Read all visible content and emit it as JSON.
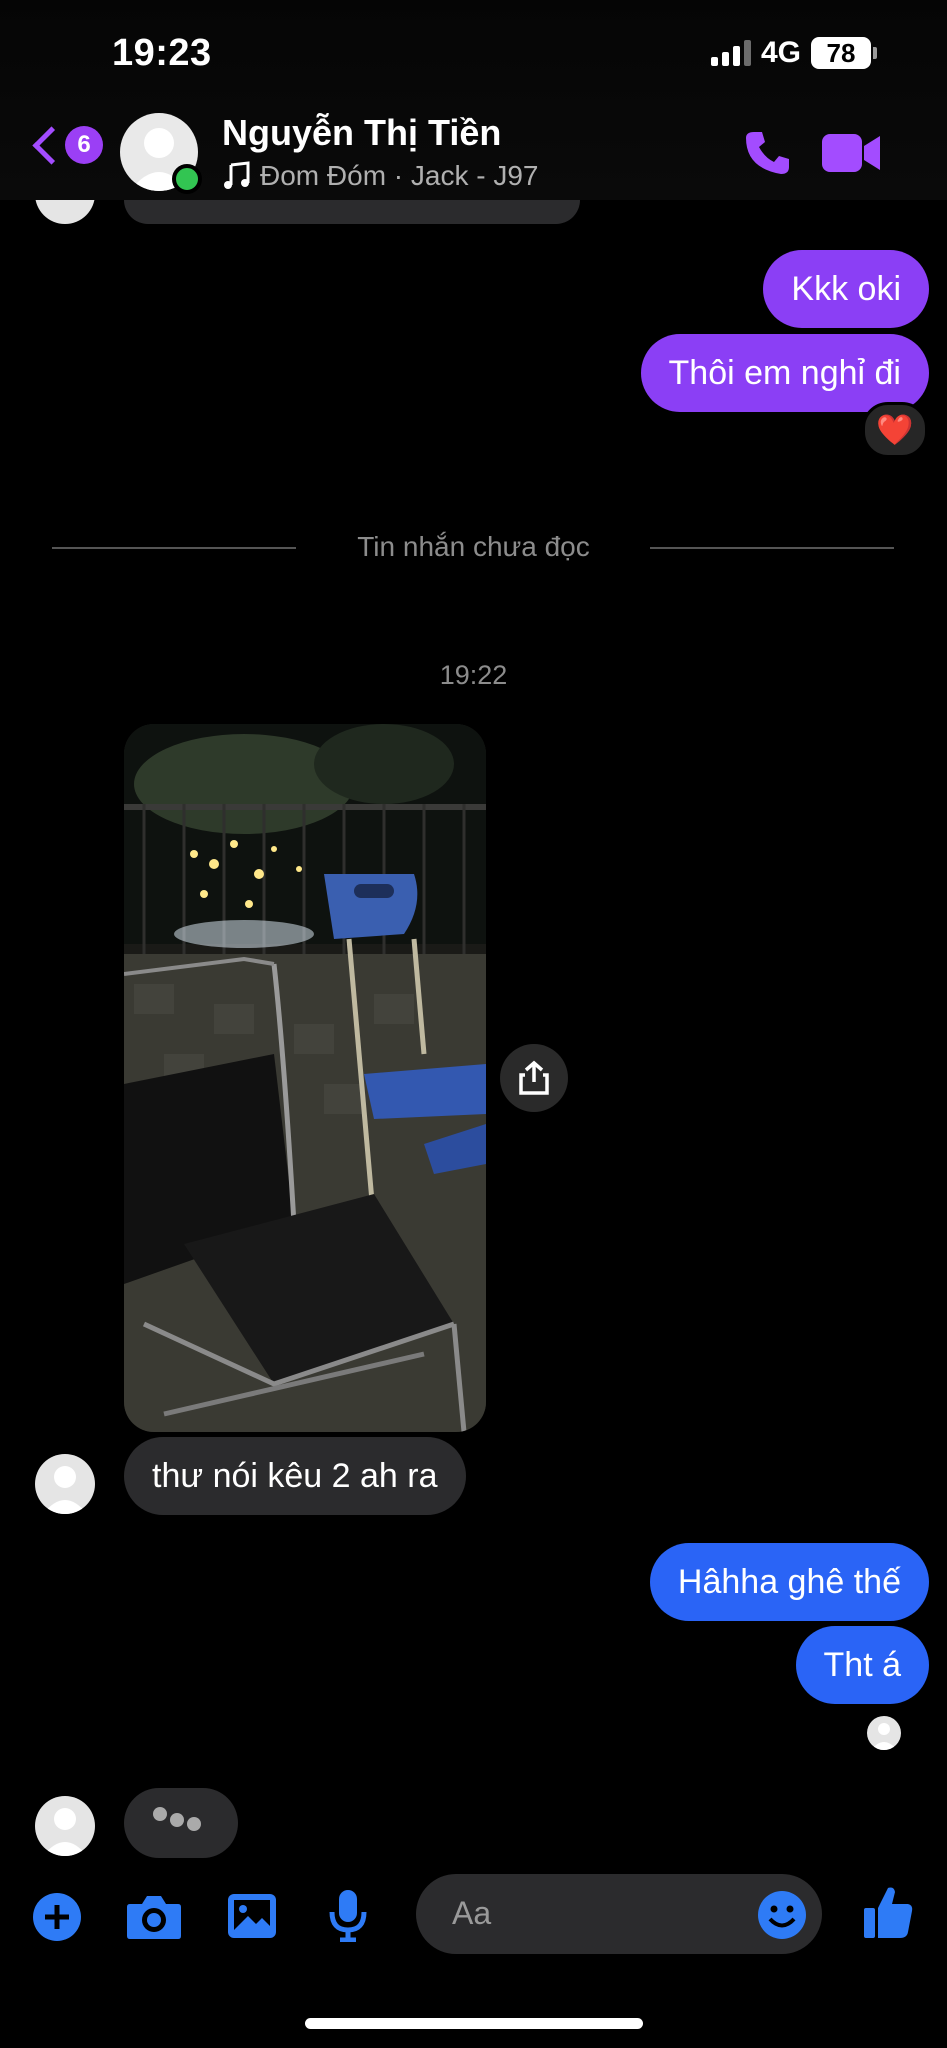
{
  "status_bar": {
    "time": "19:23",
    "network": "4G",
    "battery": "78"
  },
  "header": {
    "back_badge": "6",
    "contact_name": "Nguyễn Thị Tiền",
    "now_playing": "Đom Đóm · Jack - J97"
  },
  "messages": {
    "out1": "Kkk oki",
    "out2": "Thôi em nghỉ đi",
    "out2_reaction": "❤️",
    "unread_divider": "Tin nhắn chưa đọc",
    "timestamp": "19:22",
    "in1": "thư nói kêu 2 ah ra",
    "out3": "Hâhha ghê thế",
    "out4": "Tht á"
  },
  "composer": {
    "placeholder": "Aa"
  },
  "colors": {
    "accent_purple": "#8b3ff5",
    "accent_blue": "#2a64f6",
    "icon_blue": "#2e7bf6",
    "incoming": "#2b2b2d"
  }
}
